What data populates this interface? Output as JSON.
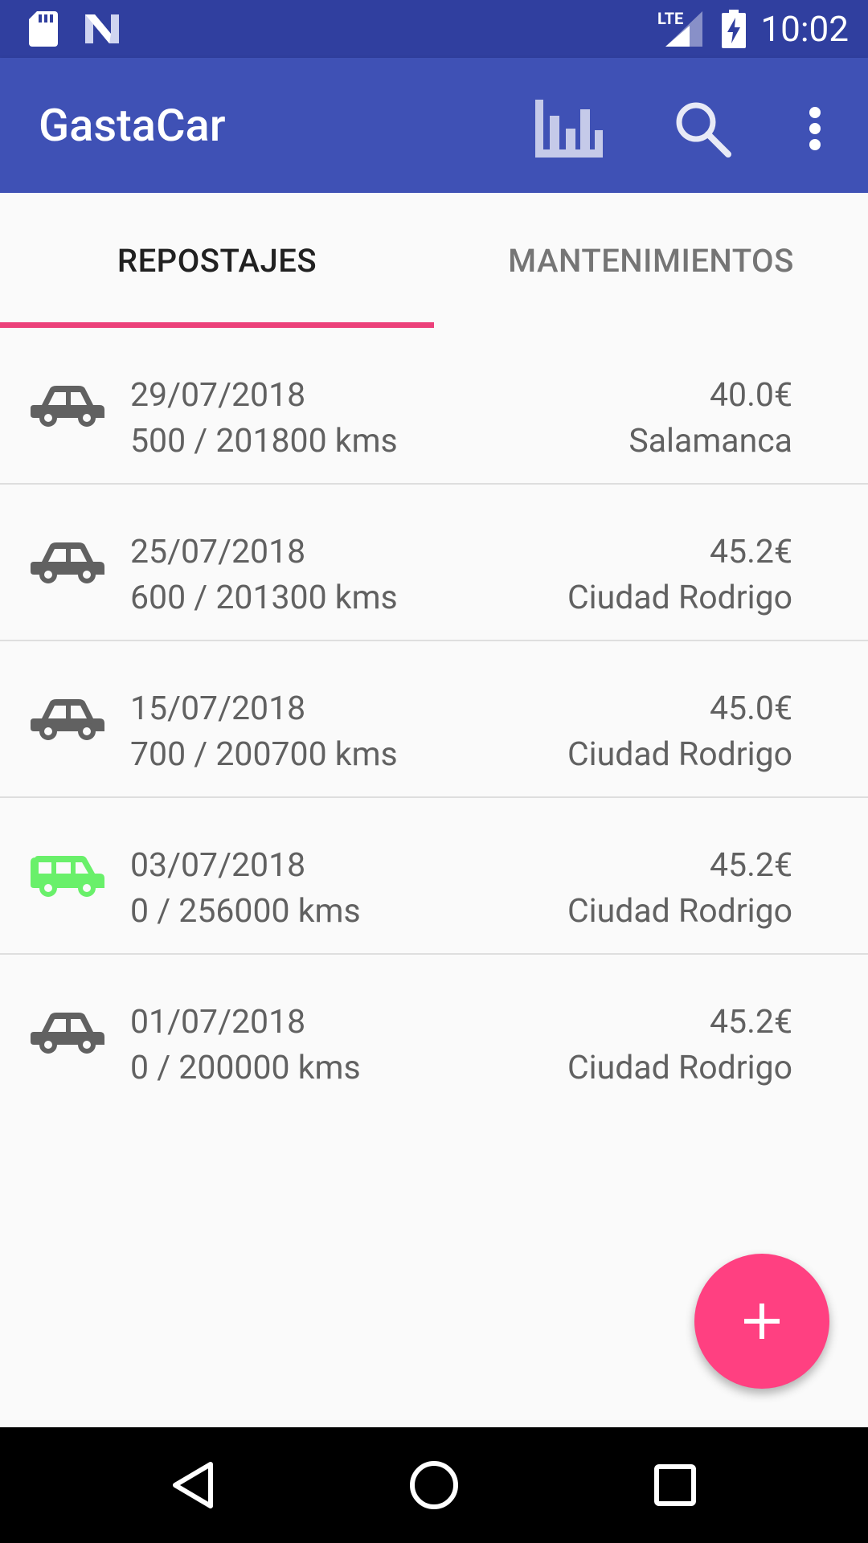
{
  "status_bar": {
    "time": "10:02",
    "network": "LTE",
    "icons": [
      "sd-card-icon",
      "n-logo-icon",
      "lte-signal-icon",
      "battery-charging-icon"
    ]
  },
  "app_bar": {
    "title": "GastaCar",
    "actions": [
      "bar-chart-icon",
      "search-icon",
      "more-vert-icon"
    ]
  },
  "tabs": [
    {
      "label": "REPOSTAJES",
      "active": true
    },
    {
      "label": "MANTENIMIENTOS",
      "active": false
    }
  ],
  "colors": {
    "primary": "#3f51b5",
    "primary_dark": "#303f9f",
    "accent": "#ff4081",
    "tab_indicator": "#ec407a",
    "car_grey": "#616161",
    "car_green": "#69f06a"
  },
  "refuels": [
    {
      "date": "29/07/2018",
      "kms": "500 / 201800 kms",
      "price": "40.0€",
      "place": "Salamanca",
      "vehicle": "car",
      "vehicle_color": "#616161"
    },
    {
      "date": "25/07/2018",
      "kms": "600 / 201300 kms",
      "price": "45.2€",
      "place": "Ciudad Rodrigo",
      "vehicle": "car",
      "vehicle_color": "#616161"
    },
    {
      "date": "15/07/2018",
      "kms": "700 / 200700 kms",
      "price": "45.0€",
      "place": "Ciudad Rodrigo",
      "vehicle": "car",
      "vehicle_color": "#616161"
    },
    {
      "date": "03/07/2018",
      "kms": "0 / 256000 kms",
      "price": "45.2€",
      "place": "Ciudad Rodrigo",
      "vehicle": "van",
      "vehicle_color": "#69f06a"
    },
    {
      "date": "01/07/2018",
      "kms": "0 / 200000 kms",
      "price": "45.2€",
      "place": "Ciudad Rodrigo",
      "vehicle": "car",
      "vehicle_color": "#616161"
    }
  ],
  "fab": {
    "icon": "add-icon"
  },
  "nav_bar": {
    "buttons": [
      "back-icon",
      "home-icon",
      "recents-icon"
    ]
  }
}
